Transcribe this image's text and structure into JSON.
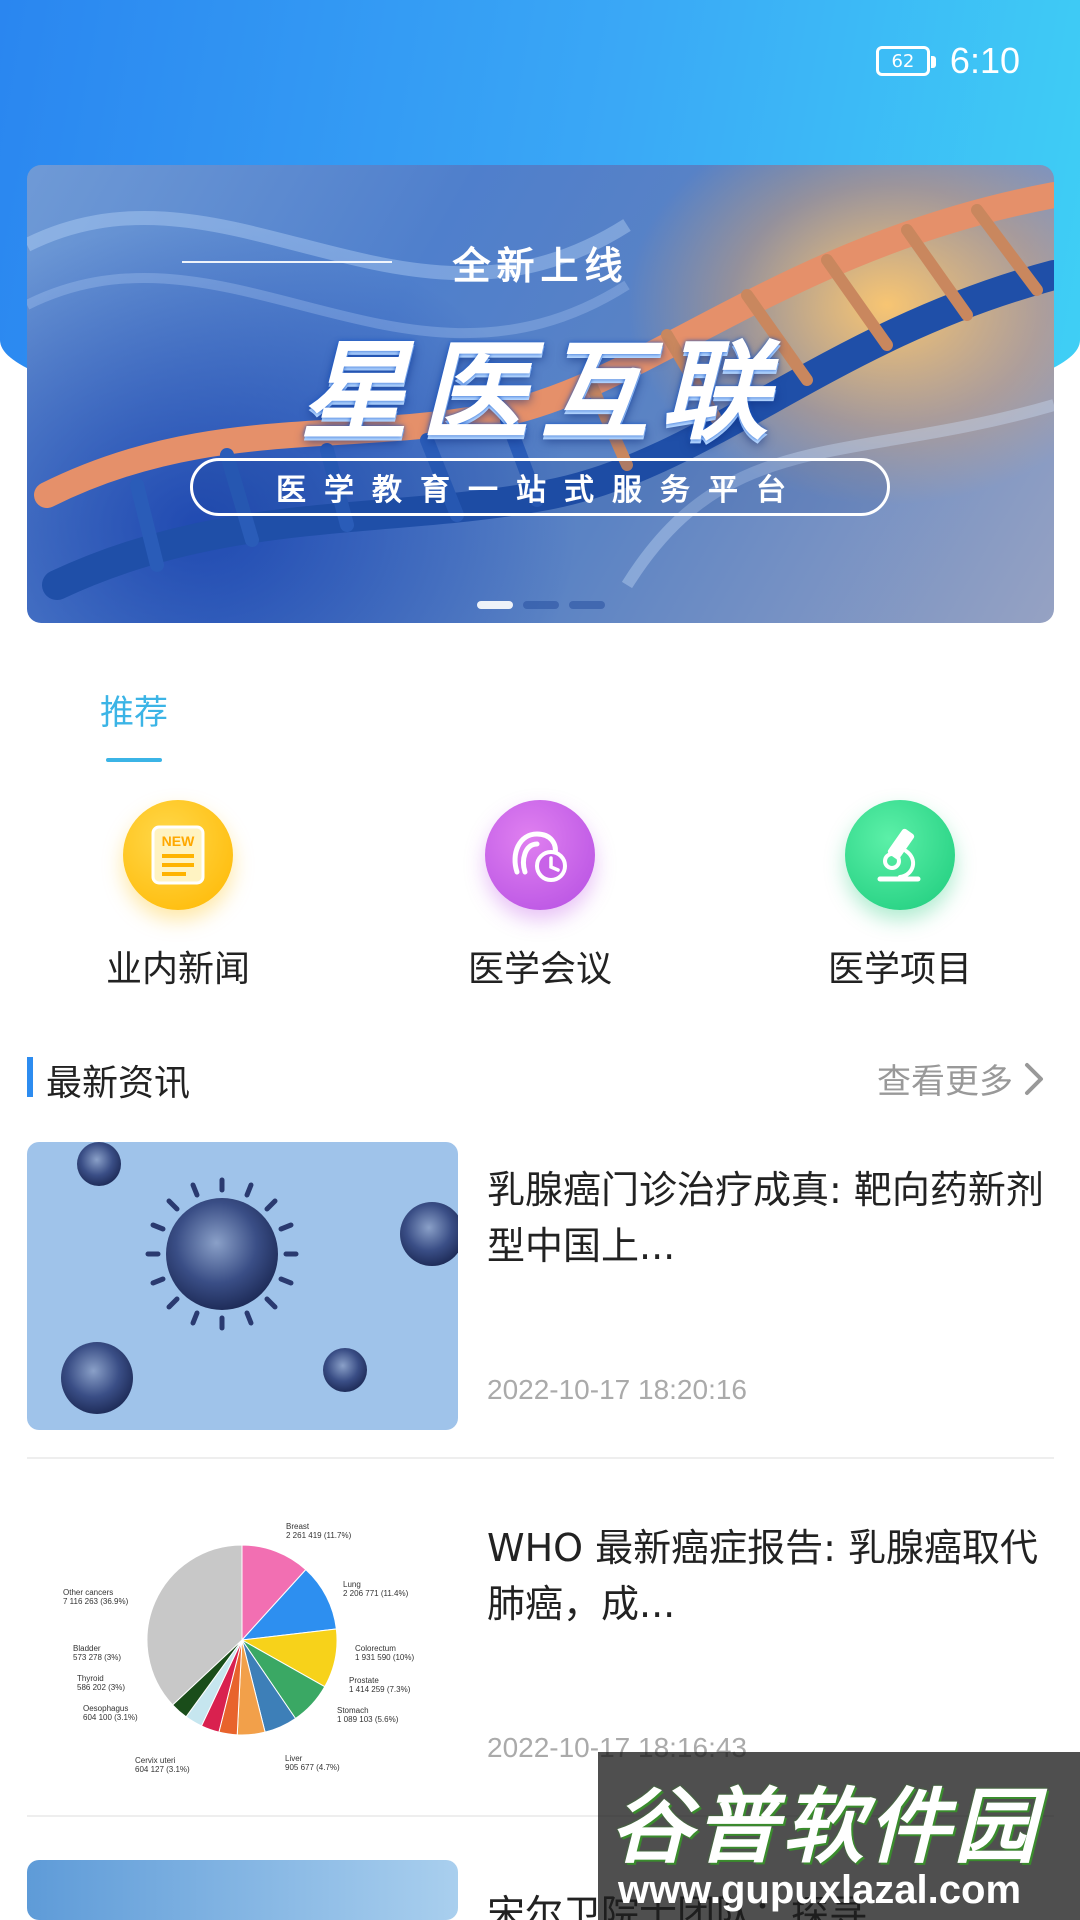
{
  "status_bar": {
    "battery": "62",
    "time": "6:10"
  },
  "banner": {
    "subtitle": "全新上线",
    "title": "星医互联",
    "tagline": "医学教育一站式服务平台",
    "slides": 3,
    "active_slide": 1
  },
  "tab": {
    "label": "推荐"
  },
  "shortcuts": [
    {
      "label": "业内新闻",
      "icon": "news-icon",
      "icon_text": "NEW"
    },
    {
      "label": "医学会议",
      "icon": "meeting-icon"
    },
    {
      "label": "医学项目",
      "icon": "microscope-icon"
    }
  ],
  "section": {
    "title": "最新资讯",
    "more": "查看更多"
  },
  "news": [
    {
      "title": "乳腺癌门诊治疗成真: 靶向药新剂型中国上...",
      "time": "2022-10-17 18:20:16"
    },
    {
      "title": "WHO 最新癌症报告: 乳腺癌取代肺癌，成...",
      "time": "2022-10-17 18:16:43"
    },
    {
      "title": "宋尔卫院士团队：探寻"
    }
  ],
  "pie": {
    "labels": [
      {
        "name": "Breast",
        "value": "2 261 419 (11.7%)"
      },
      {
        "name": "Lung",
        "value": "2 206 771 (11.4%)"
      },
      {
        "name": "Colorectum",
        "value": "1 931 590 (10%)"
      },
      {
        "name": "Prostate",
        "value": "1 414 259 (7.3%)"
      },
      {
        "name": "Stomach",
        "value": "1 089 103 (5.6%)"
      },
      {
        "name": "Liver",
        "value": "905 677 (4.7%)"
      },
      {
        "name": "Cervix uteri",
        "value": "604 127 (3.1%)"
      },
      {
        "name": "Oesophagus",
        "value": "604 100 (3.1%)"
      },
      {
        "name": "Thyroid",
        "value": "586 202 (3%)"
      },
      {
        "name": "Bladder",
        "value": "573 278 (3%)"
      },
      {
        "name": "Other cancers",
        "value": "7 116 263 (36.9%)"
      }
    ],
    "colors": [
      "#f26fb2",
      "#2d8ff0",
      "#f7d21a",
      "#3aa864",
      "#3d7fb8",
      "#f2a04a",
      "#e8632c",
      "#d9214f",
      "#c6e6ef",
      "#1a4d1a",
      "#c8c8c8"
    ],
    "shares": [
      11.7,
      11.4,
      10,
      7.3,
      5.6,
      4.7,
      3.1,
      3.1,
      3,
      3,
      36.9
    ]
  },
  "watermark": {
    "title": "谷普软件园",
    "url": "www.gupuxlazal.com"
  }
}
